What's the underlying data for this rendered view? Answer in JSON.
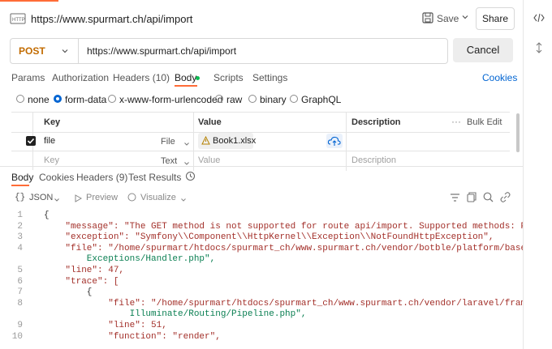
{
  "topbar": {
    "url_title": "https://www.spurmart.ch/api/import",
    "save_label": "Save",
    "share_label": "Share"
  },
  "request": {
    "method": "POST",
    "url": "https://www.spurmart.ch/api/import",
    "cancel_label": "Cancel"
  },
  "req_tabs": [
    {
      "label": "Params"
    },
    {
      "label": "Authorization"
    },
    {
      "label": "Headers (10)"
    },
    {
      "label": "Body"
    },
    {
      "label": "Scripts"
    },
    {
      "label": "Settings"
    }
  ],
  "cookies_label": "Cookies",
  "body_modes": [
    {
      "label": "none",
      "selected": false
    },
    {
      "label": "form-data",
      "selected": true
    },
    {
      "label": "x-www-form-urlencoded",
      "selected": false
    },
    {
      "label": "raw",
      "selected": false
    },
    {
      "label": "binary",
      "selected": false
    },
    {
      "label": "GraphQL",
      "selected": false
    }
  ],
  "form_table": {
    "headers": {
      "key": "Key",
      "value": "Value",
      "description": "Description",
      "bulk_edit": "Bulk Edit"
    },
    "row": {
      "key": "file",
      "type": "File",
      "value": "Book1.xlsx"
    },
    "empty_row": {
      "key_placeholder": "Key",
      "type": "Text",
      "value_placeholder": "Value",
      "description_placeholder": "Description"
    }
  },
  "resp_tabs": [
    {
      "label": "Body"
    },
    {
      "label": "Cookies"
    },
    {
      "label": "Headers (9)"
    },
    {
      "label": "Test Results"
    }
  ],
  "resp_toolbar": {
    "format": "JSON",
    "preview": "Preview",
    "visualize": "Visualize"
  },
  "code": {
    "line_numbers": [
      "1",
      "2",
      "3",
      "4",
      "",
      "5",
      "6",
      "7",
      "8",
      "",
      "9",
      "10"
    ],
    "lines": [
      "{",
      "    \"message\": \"The GET method is not supported for route api/import. Supported methods: POST.\",",
      "    \"exception\": \"Symfony\\\\Component\\\\HttpKernel\\\\Exception\\\\NotFoundHttpException\",",
      "    \"file\": \"/home/spurmart/htdocs/spurmart_ch/www.spurmart.ch/vendor/botble/platform/base/src/",
      "        Exceptions/Handler.php\",",
      "    \"line\": 47,",
      "    \"trace\": [",
      "        {",
      "            \"file\": \"/home/spurmart/htdocs/spurmart_ch/www.spurmart.ch/vendor/laravel/framework/src/",
      "                Illuminate/Routing/Pipeline.php\",",
      "            \"line\": 51,",
      "            \"function\": \"render\","
    ]
  },
  "colors": {
    "accent": "#ff6c37",
    "link": "#0265d2",
    "checkbox": "#212121",
    "body_dot": "#0cbb52"
  }
}
